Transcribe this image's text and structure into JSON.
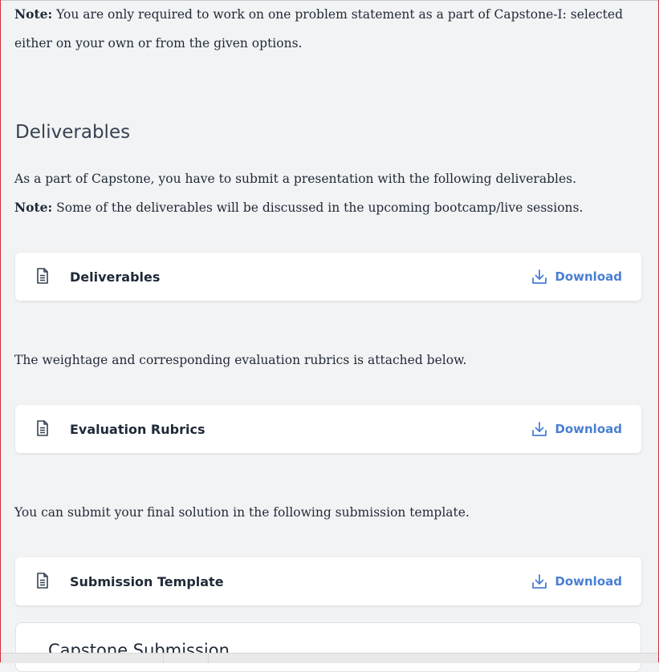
{
  "intro": {
    "note_label": "Note:",
    "note_text": " You are only required to work on one problem statement as a part of Capstone-I: selected either on your own or from the given options."
  },
  "deliverables_section": {
    "heading": "Deliverables",
    "para1": "As a part of Capstone, you have to submit a presentation with the following deliverables.",
    "note_label": "Note:",
    "note_text": " Some of the deliverables will be discussed in the upcoming bootcamp/live sessions."
  },
  "cards": [
    {
      "title": "Deliverables",
      "action": "Download",
      "icon": "document-icon",
      "action_icon": "download-icon"
    },
    {
      "title": "Evaluation Rubrics",
      "action": "Download",
      "icon": "document-icon",
      "action_icon": "download-icon"
    },
    {
      "title": "Submission Template",
      "action": "Download",
      "icon": "document-icon",
      "action_icon": "download-icon"
    }
  ],
  "rubrics_text": "The weightage and corresponding evaluation rubrics is attached below.",
  "submission_text": "You can submit your final solution in the following submission template.",
  "submission_card": {
    "title": "Capstone Submission"
  },
  "colors": {
    "accent": "#4a7fd1",
    "background": "#f2f3f4",
    "card": "#ffffff",
    "text": "#1f2937"
  }
}
